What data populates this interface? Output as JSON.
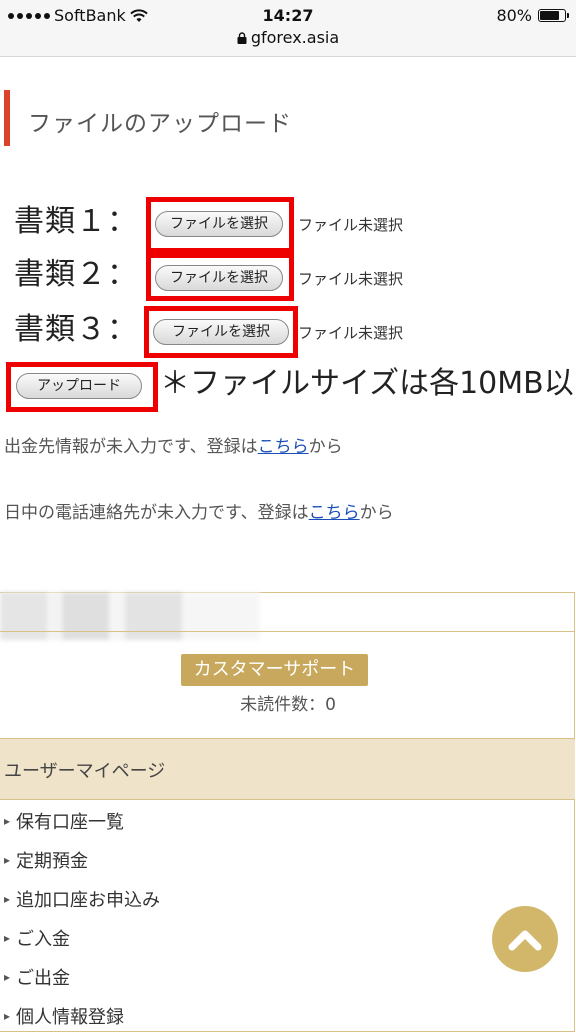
{
  "status": {
    "carrier": "SoftBank",
    "time": "14:27",
    "url": "gforex.asia",
    "battery": "80%",
    "battery_level": 0.8
  },
  "page": {
    "section_title": "ファイルのアップロード",
    "documents": [
      {
        "label": "書類１：",
        "button": "ファイルを選択",
        "status": "ファイル未選択"
      },
      {
        "label": "書類２：",
        "button": "ファイルを選択",
        "status": "ファイル未選択"
      },
      {
        "label": "書類３：",
        "button": "ファイルを選択",
        "status": "ファイル未選択"
      }
    ],
    "upload_button": "アップロード",
    "note": "＊ファイルサイズは各10MB以",
    "bank_info_prefix": "出金先情報が未入力です、登録は",
    "bank_info_link": "こちら",
    "bank_info_suffix": "から",
    "phone_info_prefix": "日中の電話連絡先が未入力です、登録は",
    "phone_info_link": "こちら",
    "phone_info_suffix": "から"
  },
  "member": {
    "support_button": "カスタマーサポート",
    "unread": "未読件数：0",
    "mypage_title": "ユーザーマイページ",
    "menu": [
      "保有口座一覧",
      "定期預金",
      "追加口座お申込み",
      "ご入金",
      "ご出金",
      "個人情報登録"
    ]
  },
  "colors": {
    "accent_red": "#d9432b",
    "highlight_red": "#ee0000",
    "gold": "#c8a85c",
    "link": "#1a4fb8"
  },
  "icons": {
    "wifi": "wifi-icon",
    "lock": "lock-icon",
    "battery": "battery-icon",
    "scroll_top": "chevron-up-icon"
  }
}
